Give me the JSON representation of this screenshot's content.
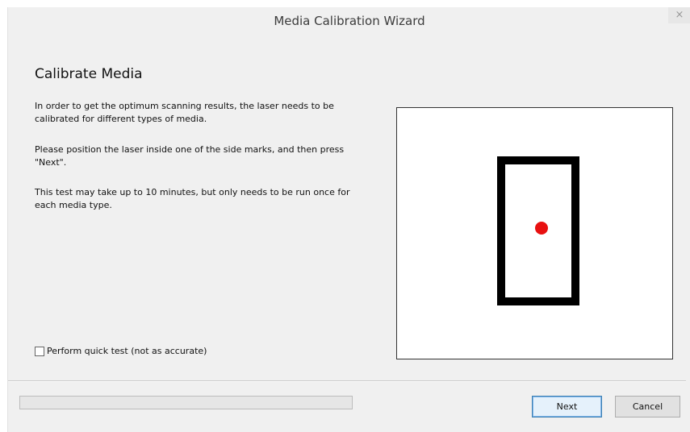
{
  "window": {
    "title": "Media Calibration Wizard",
    "close_glyph": "×"
  },
  "content": {
    "heading": "Calibrate Media",
    "paragraph1": "In order to get the optimum scanning results, the laser needs to be calibrated for different types of media.",
    "paragraph2": "Please position the laser inside one of the side marks, and then press \"Next\".",
    "paragraph3": " This test may take up to 10 minutes, but only needs to be run once for each media type."
  },
  "preview": {
    "mark_color": "#000000",
    "laser_dot_color": "#e81010",
    "background": "#ffffff"
  },
  "options": {
    "quick_test_label": "Perform quick test (not as accurate)",
    "quick_test_checked": false
  },
  "progress": {
    "percent": 0
  },
  "buttons": {
    "next_label": "Next",
    "cancel_label": "Cancel"
  }
}
